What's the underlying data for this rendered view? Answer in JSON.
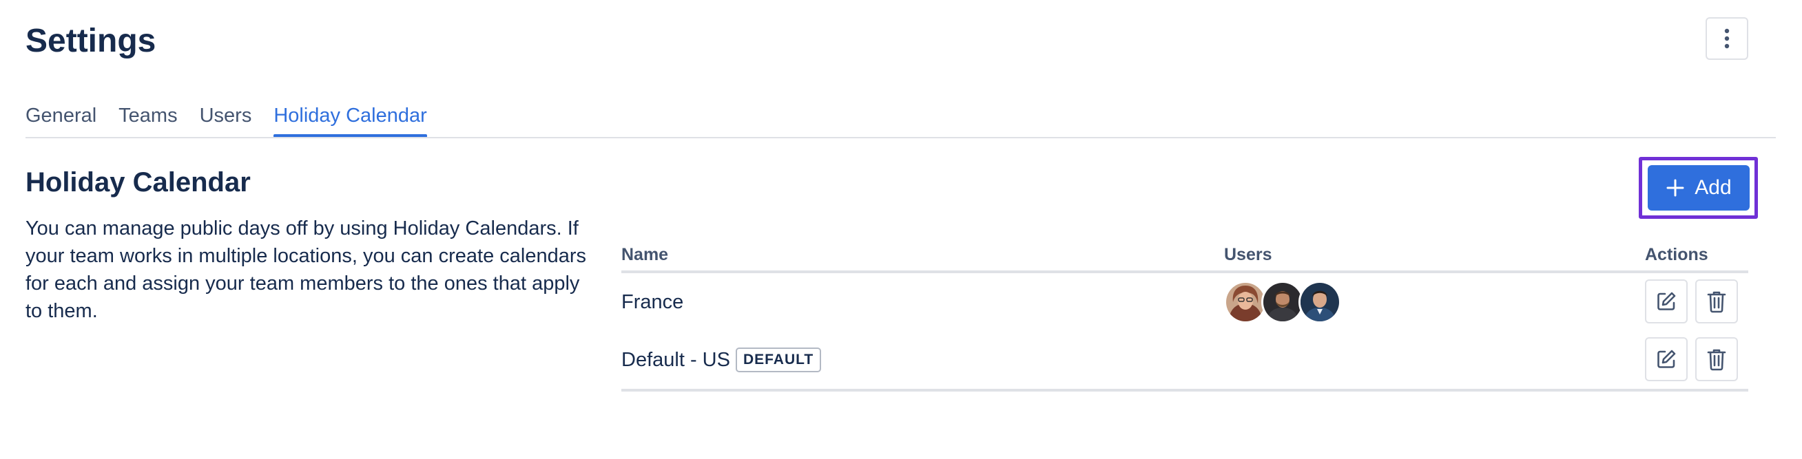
{
  "header": {
    "title": "Settings",
    "more_icon": "more-vertical-icon"
  },
  "tabs": [
    {
      "label": "General",
      "active": false
    },
    {
      "label": "Teams",
      "active": false
    },
    {
      "label": "Users",
      "active": false
    },
    {
      "label": "Holiday Calendar",
      "active": true
    }
  ],
  "section": {
    "title": "Holiday Calendar",
    "description": "You can manage public days off by using Holiday Calendars. If your team works in multiple locations, you can create calendars for each and assign your team members to the ones that apply to them.",
    "add_label": "Add",
    "add_icon": "plus-icon"
  },
  "table": {
    "columns": [
      "Name",
      "Users",
      "Actions"
    ],
    "rows": [
      {
        "name": "France",
        "badge": "",
        "users": [
          "avatar-woman-glasses",
          "avatar-man-beard",
          "avatar-man-blue"
        ]
      },
      {
        "name": "Default - US",
        "badge": "DEFAULT",
        "users": []
      }
    ],
    "edit_icon": "edit-icon",
    "delete_icon": "trash-icon"
  },
  "colors": {
    "primary": "#2f6fdd",
    "focus_ring": "#7030d6",
    "text": "#172b4d",
    "border": "#dfe1e6"
  }
}
